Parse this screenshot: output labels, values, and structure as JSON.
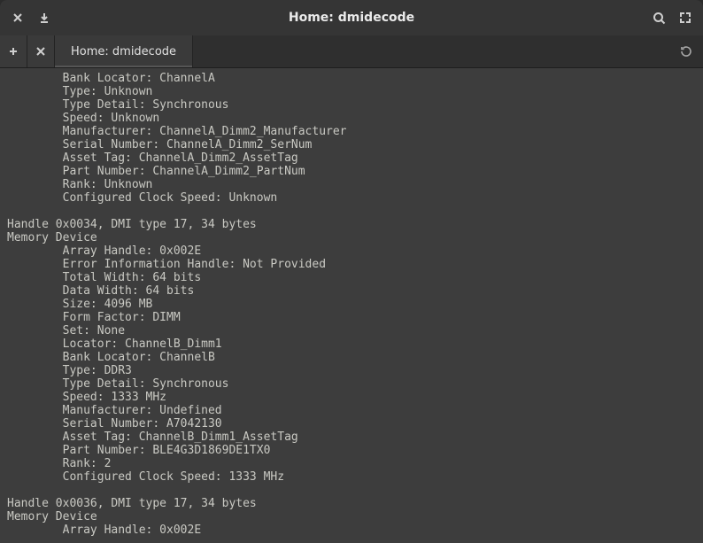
{
  "window": {
    "title": "Home: dmidecode"
  },
  "tabs": {
    "active_label": "Home: dmidecode"
  },
  "terminal": {
    "lines": [
      "        Bank Locator: ChannelA",
      "        Type: Unknown",
      "        Type Detail: Synchronous",
      "        Speed: Unknown",
      "        Manufacturer: ChannelA_Dimm2_Manufacturer",
      "        Serial Number: ChannelA_Dimm2_SerNum",
      "        Asset Tag: ChannelA_Dimm2_AssetTag",
      "        Part Number: ChannelA_Dimm2_PartNum",
      "        Rank: Unknown",
      "        Configured Clock Speed: Unknown",
      "",
      "Handle 0x0034, DMI type 17, 34 bytes",
      "Memory Device",
      "        Array Handle: 0x002E",
      "        Error Information Handle: Not Provided",
      "        Total Width: 64 bits",
      "        Data Width: 64 bits",
      "        Size: 4096 MB",
      "        Form Factor: DIMM",
      "        Set: None",
      "        Locator: ChannelB_Dimm1",
      "        Bank Locator: ChannelB",
      "        Type: DDR3",
      "        Type Detail: Synchronous",
      "        Speed: 1333 MHz",
      "        Manufacturer: Undefined",
      "        Serial Number: A7042130",
      "        Asset Tag: ChannelB_Dimm1_AssetTag",
      "        Part Number: BLE4G3D1869DE1TX0",
      "        Rank: 2",
      "        Configured Clock Speed: 1333 MHz",
      "",
      "Handle 0x0036, DMI type 17, 34 bytes",
      "Memory Device",
      "        Array Handle: 0x002E"
    ]
  }
}
